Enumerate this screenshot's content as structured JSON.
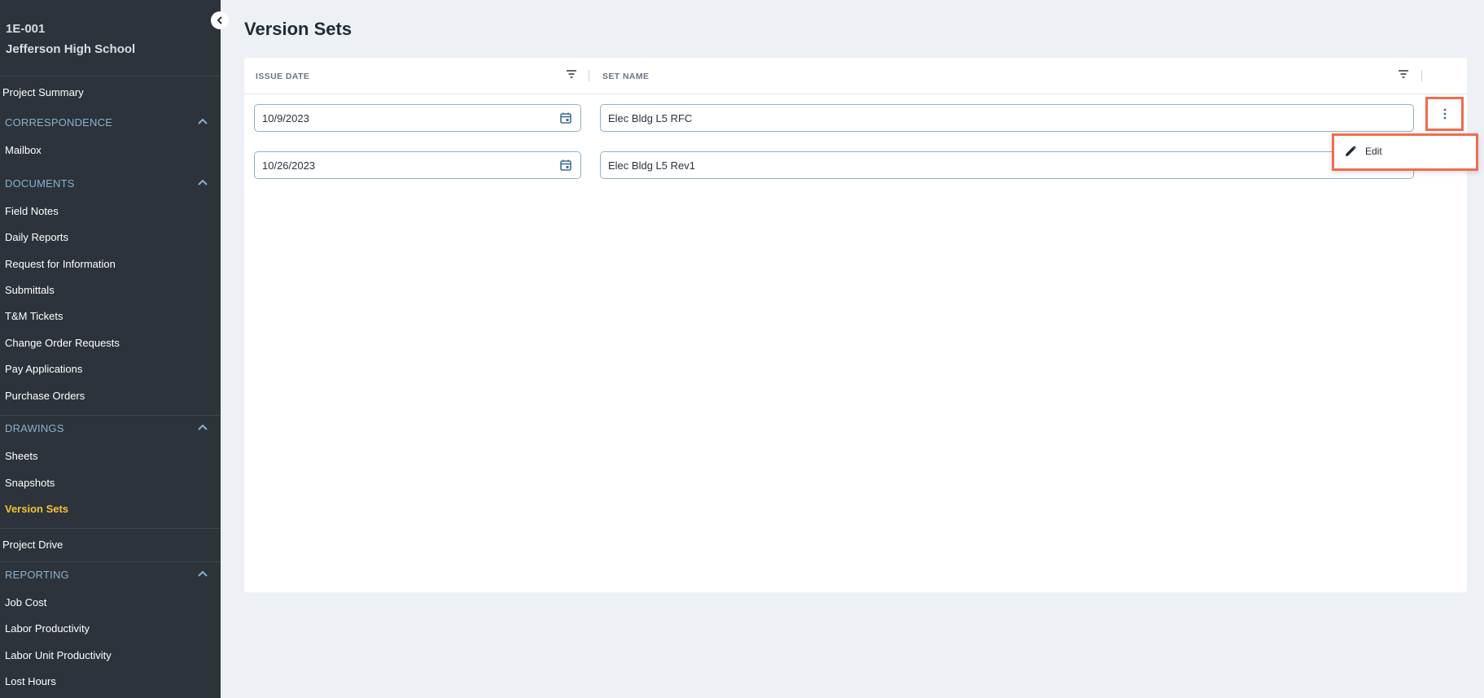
{
  "project": {
    "code": "1E-001",
    "name": "Jefferson High School"
  },
  "nav": {
    "project_summary": "Project Summary",
    "correspondence": {
      "label": "CORRESPONDENCE",
      "items": [
        "Mailbox"
      ]
    },
    "documents": {
      "label": "DOCUMENTS",
      "items": [
        "Field Notes",
        "Daily Reports",
        "Request for Information",
        "Submittals",
        "T&M Tickets",
        "Change Order Requests",
        "Pay Applications",
        "Purchase Orders"
      ]
    },
    "drawings": {
      "label": "DRAWINGS",
      "items": [
        "Sheets",
        "Snapshots",
        "Version Sets"
      ]
    },
    "project_drive": "Project Drive",
    "reporting": {
      "label": "REPORTING",
      "items": [
        "Job Cost",
        "Labor Productivity",
        "Labor Unit Productivity",
        "Lost Hours"
      ]
    }
  },
  "page": {
    "title": "Version Sets"
  },
  "table": {
    "columns": [
      "ISSUE DATE",
      "SET NAME"
    ],
    "rows": [
      {
        "issue_date": "10/9/2023",
        "set_name": "Elec Bldg L5 RFC"
      },
      {
        "issue_date": "10/26/2023",
        "set_name": "Elec Bldg L5 Rev1"
      }
    ]
  },
  "row_menu": {
    "items": [
      "Edit"
    ]
  },
  "colors": {
    "sidebar_bg": "#2c333a",
    "active_nav": "#f3c233",
    "section_label": "#8bb0cf",
    "highlight": "#f26b4f"
  }
}
